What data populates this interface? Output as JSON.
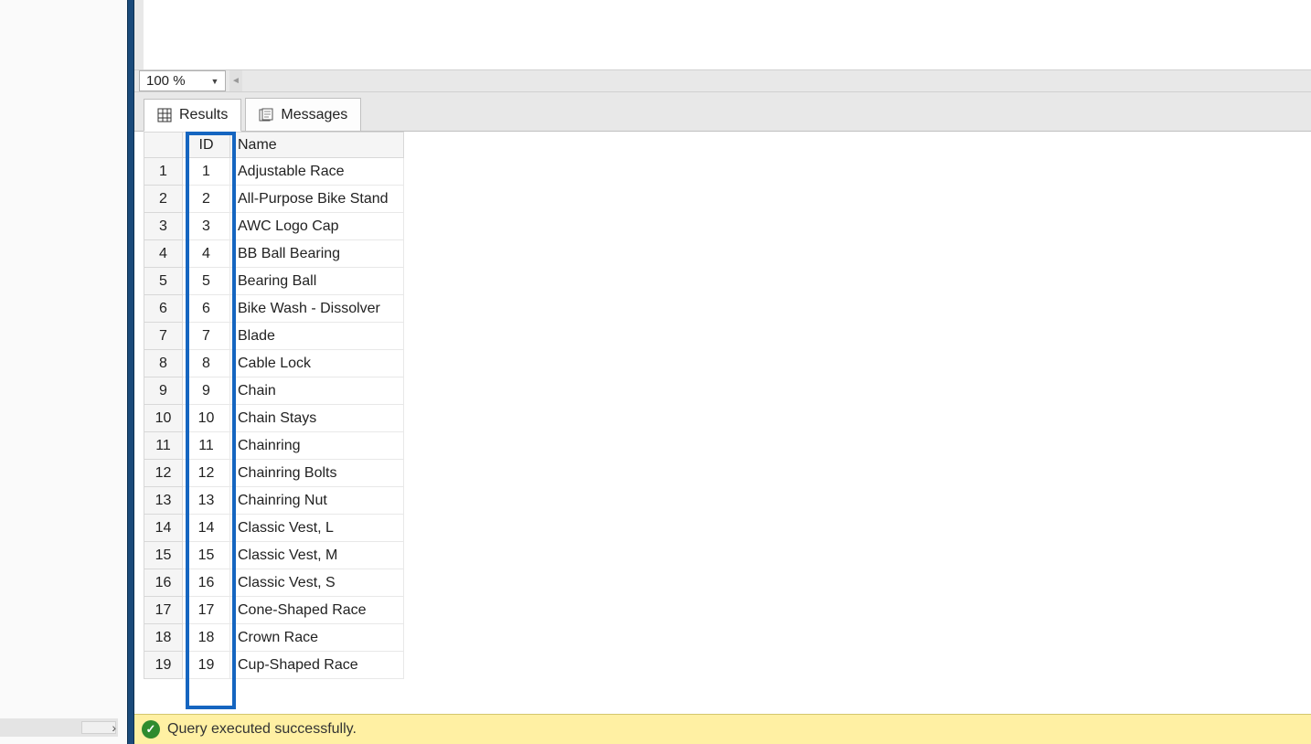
{
  "zoom": {
    "level": "100 %"
  },
  "tabs": {
    "results_label": "Results",
    "messages_label": "Messages"
  },
  "grid": {
    "columns": [
      "ID",
      "Name"
    ],
    "rows": [
      {
        "rownum": "1",
        "id": "1",
        "name": "Adjustable Race"
      },
      {
        "rownum": "2",
        "id": "2",
        "name": "All-Purpose Bike Stand"
      },
      {
        "rownum": "3",
        "id": "3",
        "name": "AWC Logo Cap"
      },
      {
        "rownum": "4",
        "id": "4",
        "name": "BB Ball Bearing"
      },
      {
        "rownum": "5",
        "id": "5",
        "name": "Bearing Ball"
      },
      {
        "rownum": "6",
        "id": "6",
        "name": "Bike Wash - Dissolver"
      },
      {
        "rownum": "7",
        "id": "7",
        "name": "Blade"
      },
      {
        "rownum": "8",
        "id": "8",
        "name": "Cable Lock"
      },
      {
        "rownum": "9",
        "id": "9",
        "name": "Chain"
      },
      {
        "rownum": "10",
        "id": "10",
        "name": "Chain Stays"
      },
      {
        "rownum": "11",
        "id": "11",
        "name": "Chainring"
      },
      {
        "rownum": "12",
        "id": "12",
        "name": "Chainring Bolts"
      },
      {
        "rownum": "13",
        "id": "13",
        "name": "Chainring Nut"
      },
      {
        "rownum": "14",
        "id": "14",
        "name": "Classic Vest, L"
      },
      {
        "rownum": "15",
        "id": "15",
        "name": "Classic Vest, M"
      },
      {
        "rownum": "16",
        "id": "16",
        "name": "Classic Vest, S"
      },
      {
        "rownum": "17",
        "id": "17",
        "name": "Cone-Shaped Race"
      },
      {
        "rownum": "18",
        "id": "18",
        "name": "Crown Race"
      },
      {
        "rownum": "19",
        "id": "19",
        "name": "Cup-Shaped Race"
      }
    ]
  },
  "status": {
    "message": "Query executed successfully."
  }
}
